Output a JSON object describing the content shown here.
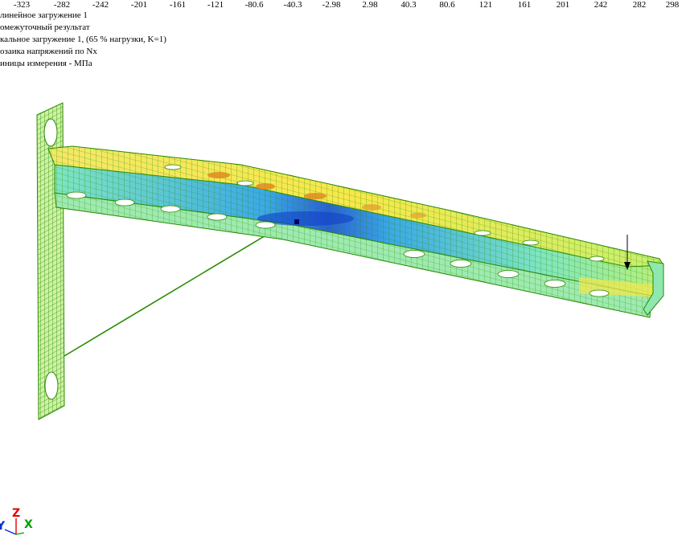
{
  "scale_ticks": [
    "-323",
    "-282",
    "-242",
    "-201",
    "-161",
    "-121",
    "-80.6",
    "-40.3",
    "-2.98",
    "2.98",
    "40.3",
    "80.6",
    "121",
    "161",
    "201",
    "242",
    "282",
    "298"
  ],
  "info_lines": [
    "линейное загружение 1",
    "омежуточный результат",
    "кальное загружение 1, (65 % нагрузки, K=1)",
    "озаика напряжений по Nx",
    "иницы измерения - МПа"
  ],
  "axes": {
    "z": "Z",
    "x": "X",
    "y": "Y"
  },
  "colors": {
    "mesh": "#2a8a00",
    "stress_high": "#f7e84a",
    "stress_peak": "#e08a20",
    "stress_mid": "#7fe6c0",
    "stress_low": "#3aa8e8",
    "stress_min": "#1040c8",
    "z_axis": "#e00000",
    "x_axis": "#00a000",
    "y_axis": "#0030d0"
  }
}
